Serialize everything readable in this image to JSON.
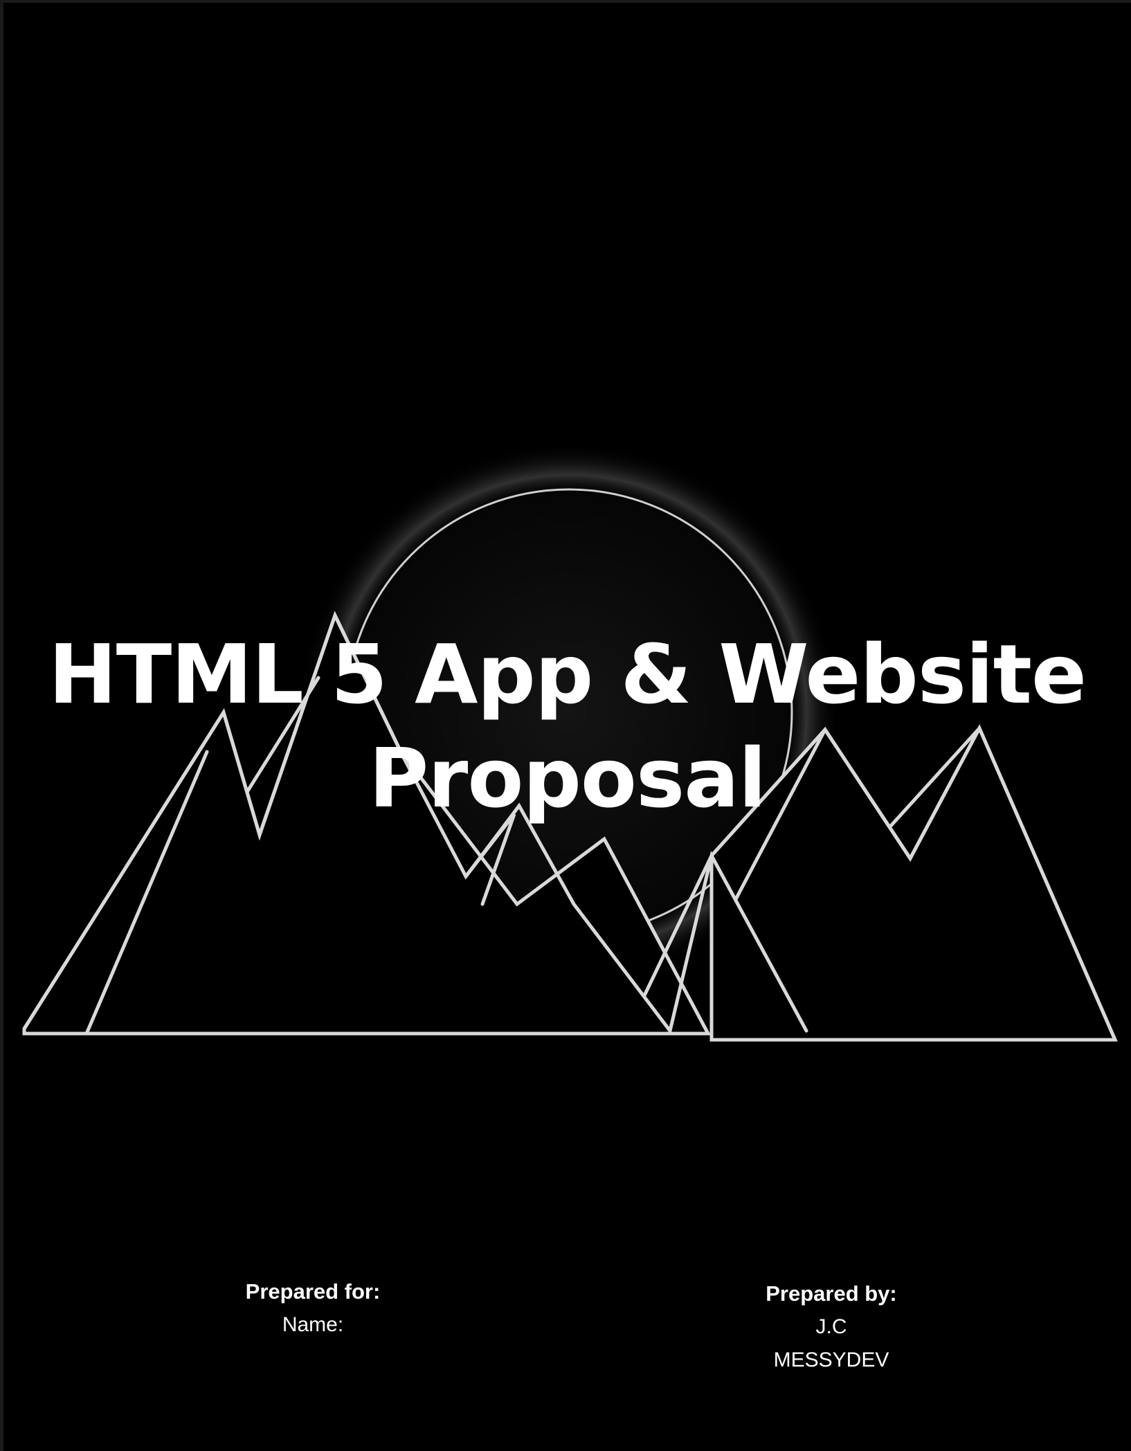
{
  "cover": {
    "title_line_1": "HTML 5 App & Website",
    "title_line_2": "Proposal"
  },
  "prepared_for": {
    "label": "Prepared for:",
    "name": "Name:"
  },
  "prepared_by": {
    "label": "Prepared by:",
    "line_1": "J.C",
    "line_2": "MESSYDEV"
  },
  "colors": {
    "background": "#000000",
    "text": "#ffffff",
    "line_art": "#d9d9d9",
    "border": "#1b1b1b"
  },
  "graphics": {
    "illustration": "moon-over-mountains line art"
  }
}
